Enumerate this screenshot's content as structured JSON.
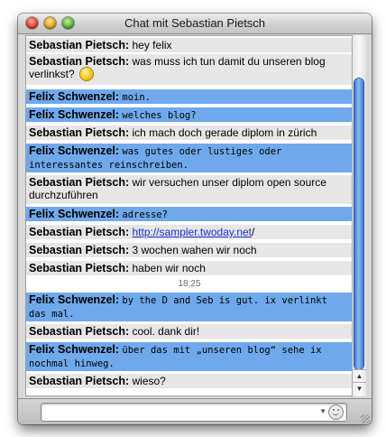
{
  "window": {
    "title": "Chat mit Sebastian Pietsch"
  },
  "messages": [
    {
      "sender": "Sebastian Pietsch:",
      "text": "hey felix",
      "who": "seb"
    },
    {
      "sender": "Sebastian Pietsch:",
      "text": "was muss ich tun damit du unseren blog verlinkst?",
      "who": "seb",
      "emoticon": "smiley-icon"
    },
    {
      "sender": "Felix Schwenzel:",
      "text": "moin.",
      "who": "felix"
    },
    {
      "sender": "Felix Schwenzel:",
      "text": "welches blog?",
      "who": "felix"
    },
    {
      "sender": "Sebastian Pietsch:",
      "text": "ich mach doch gerade diplom in zürich",
      "who": "seb"
    },
    {
      "sender": "Felix Schwenzel:",
      "text": "was gutes oder lustiges oder interessantes reinschreiben.",
      "who": "felix"
    },
    {
      "sender": "Sebastian Pietsch:",
      "text": "wir versuchen unser diplom open source durchzuführen",
      "who": "seb"
    },
    {
      "sender": "Felix Schwenzel:",
      "text": "adresse?",
      "who": "felix"
    },
    {
      "sender": "Sebastian Pietsch:",
      "link": "http://sampler.twoday.net",
      "after": "/",
      "who": "seb"
    },
    {
      "sender": "Sebastian Pietsch:",
      "text": "3 wochen wahen wir noch",
      "who": "seb"
    },
    {
      "sender": "Sebastian Pietsch:",
      "text": "haben wir noch",
      "who": "seb"
    },
    {
      "sender": "Felix Schwenzel:",
      "text": "by the D and Seb is gut. ix verlinkt das mal.",
      "who": "felix"
    },
    {
      "sender": "Sebastian Pietsch:",
      "text": "cool. dank dir!",
      "who": "seb"
    },
    {
      "sender": "Felix Schwenzel:",
      "text": "über das mit „unseren blog“ sehe ix nochmal hinweg.",
      "who": "felix"
    },
    {
      "sender": "Sebastian Pietsch:",
      "text": "wieso?",
      "who": "seb"
    }
  ],
  "timestamp": "18:25",
  "input": {
    "value": "",
    "placeholder": ""
  },
  "colors": {
    "felix_row": "#6fa9ec",
    "seb_row": "#e6e6e6",
    "scroll_thumb": "#3d72c8"
  }
}
